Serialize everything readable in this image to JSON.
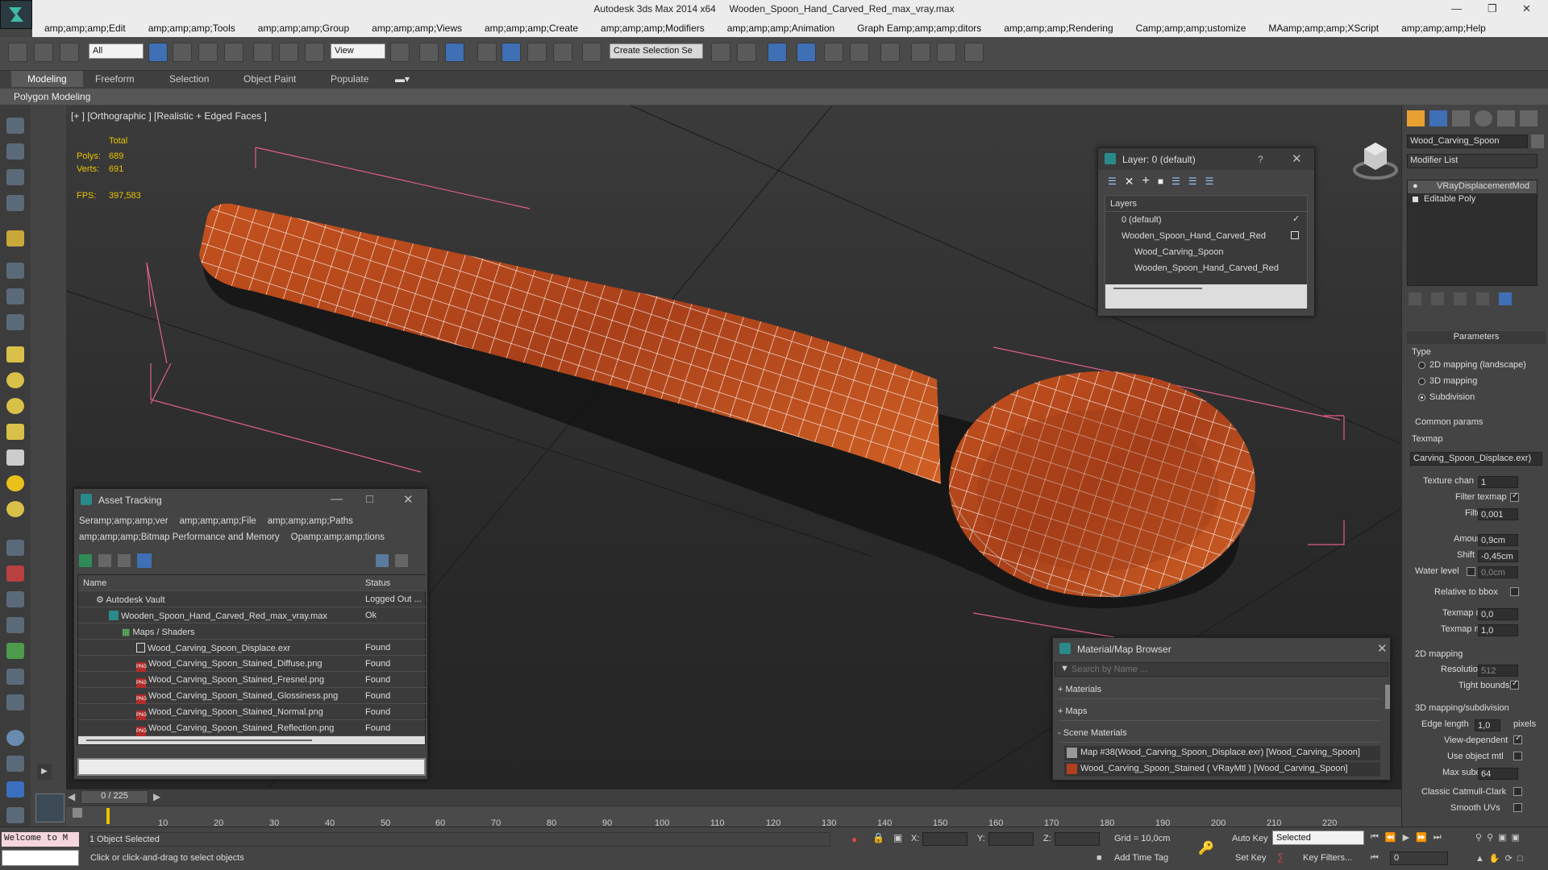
{
  "app": {
    "title_product": "Autodesk 3ds Max  2014 x64",
    "title_file": "Wooden_Spoon_Hand_Carved_Red_max_vray.max"
  },
  "menu": [
    "amp;amp;amp;Edit",
    "amp;amp;amp;Tools",
    "amp;amp;amp;Group",
    "amp;amp;amp;Views",
    "amp;amp;amp;Create",
    "amp;amp;amp;Modifiers",
    "amp;amp;amp;Animation",
    "Graph Eamp;amp;amp;ditors",
    "amp;amp;amp;Rendering",
    "Camp;amp;amp;ustomize",
    "MAamp;amp;amp;XScript",
    "amp;amp;amp;Help"
  ],
  "toolbar": {
    "filter_value": "All",
    "refcoord_value": "View",
    "selection_set_placeholder": "Create Selection Se"
  },
  "ribbon": {
    "tabs": [
      "Modeling",
      "Freeform",
      "Selection",
      "Object Paint",
      "Populate"
    ],
    "sub_label": "Polygon Modeling"
  },
  "viewport": {
    "label": "[+ ] [Orthographic ] [Realistic + Edged Faces ]",
    "stats": {
      "total_label": "Total",
      "polys_label": "Polys:",
      "polys_value": "689",
      "verts_label": "Verts:",
      "verts_value": "691",
      "fps_label": "FPS:",
      "fps_value": "397,583"
    }
  },
  "layer_dialog": {
    "title": "Layer: 0 (default)",
    "help": "?",
    "header": "Layers",
    "items": [
      "0 (default)",
      "Wooden_Spoon_Hand_Carved_Red",
      "Wood_Carving_Spoon",
      "Wooden_Spoon_Hand_Carved_Red"
    ]
  },
  "asset_tracking": {
    "title": "Asset Tracking",
    "menu_row1": [
      "Seramp;amp;amp;ver",
      "amp;amp;amp;File",
      "amp;amp;amp;Paths"
    ],
    "menu_row2": [
      "amp;amp;amp;Bitmap Performance and Memory",
      "Opamp;amp;amp;tions"
    ],
    "col_name": "Name",
    "col_status": "Status",
    "rows": [
      {
        "name": "Autodesk Vault",
        "status": "Logged Out ..."
      },
      {
        "name": "Wooden_Spoon_Hand_Carved_Red_max_vray.max",
        "status": "Ok"
      },
      {
        "name": "Maps / Shaders",
        "status": ""
      },
      {
        "name": "Wood_Carving_Spoon_Displace.exr",
        "status": "Found"
      },
      {
        "name": "Wood_Carving_Spoon_Stained_Diffuse.png",
        "status": "Found"
      },
      {
        "name": "Wood_Carving_Spoon_Stained_Fresnel.png",
        "status": "Found"
      },
      {
        "name": "Wood_Carving_Spoon_Stained_Glossiness.png",
        "status": "Found"
      },
      {
        "name": "Wood_Carving_Spoon_Stained_Normal.png",
        "status": "Found"
      },
      {
        "name": "Wood_Carving_Spoon_Stained_Reflection.png",
        "status": "Found"
      }
    ]
  },
  "material_browser": {
    "title": "Material/Map Browser",
    "search_placeholder": "Search by Name ...",
    "sections": [
      "+ Materials",
      "+ Maps",
      "- Scene Materials"
    ],
    "entries": [
      "Map #38(Wood_Carving_Spoon_Displace.exr) [Wood_Carving_Spoon]",
      "Wood_Carving_Spoon_Stained ( VRayMtl ) [Wood_Carving_Spoon]"
    ]
  },
  "command_panel": {
    "object_name": "Wood_Carving_Spoon",
    "modifier_list": "Modifier List",
    "stack": [
      "VRayDisplacementMod",
      "Editable Poly"
    ],
    "rollout": "Parameters",
    "type_label": "Type",
    "type_options": [
      "2D mapping (landscape)",
      "3D mapping",
      "Subdivision"
    ],
    "common_params": "Common params",
    "texmap_label": "Texmap",
    "texmap_value": "Carving_Spoon_Displace.exr)",
    "texture_chan_label": "Texture chan",
    "texture_chan_value": "1",
    "filter_texmap_label": "Filter texmap",
    "filter_blur_label": "Filter blur",
    "filter_blur_value": "0,001",
    "amount_label": "Amount",
    "amount_value": "0,9cm",
    "shift_label": "Shift",
    "shift_value": "-0,45cm",
    "water_level_label": "Water level",
    "water_level_value": "0,0cm",
    "relative_bbox_label": "Relative to bbox",
    "texmap_min_label": "Texmap min",
    "texmap_min_value": "0,0",
    "texmap_max_label": "Texmap max",
    "texmap_max_value": "1,0",
    "mapping2d_label": "2D mapping",
    "resolution_label": "Resolution",
    "resolution_value": "512",
    "tight_bounds_label": "Tight bounds",
    "mapping3d_label": "3D mapping/subdivision",
    "edge_length_label": "Edge length",
    "edge_length_value": "1,0",
    "pixels_label": "pixels",
    "view_dependent_label": "View-dependent",
    "use_object_mtl_label": "Use object mtl",
    "max_subdivs_label": "Max subdivs",
    "max_subdivs_value": "64",
    "classic_cc_label": "Classic Catmull-Clark",
    "smooth_uvs_label": "Smooth UVs"
  },
  "timeline": {
    "frame_display": "0 / 225",
    "ticks": [
      "10",
      "20",
      "30",
      "40",
      "50",
      "60",
      "70",
      "80",
      "90",
      "100",
      "110",
      "120",
      "130",
      "140",
      "150",
      "160",
      "170",
      "180",
      "190",
      "200",
      "210",
      "220"
    ]
  },
  "status": {
    "maxscript_listener": "Welcome to M",
    "selection_info": "1 Object Selected",
    "prompt": "Click or click-and-drag to select objects",
    "x_label": "X:",
    "y_label": "Y:",
    "z_label": "Z:",
    "grid": "Grid = 10,0cm",
    "add_time_tag": "Add Time Tag",
    "auto_key": "Auto Key",
    "set_key": "Set Key",
    "selected_value": "Selected",
    "key_filters": "Key Filters...",
    "frame_value": "0"
  }
}
